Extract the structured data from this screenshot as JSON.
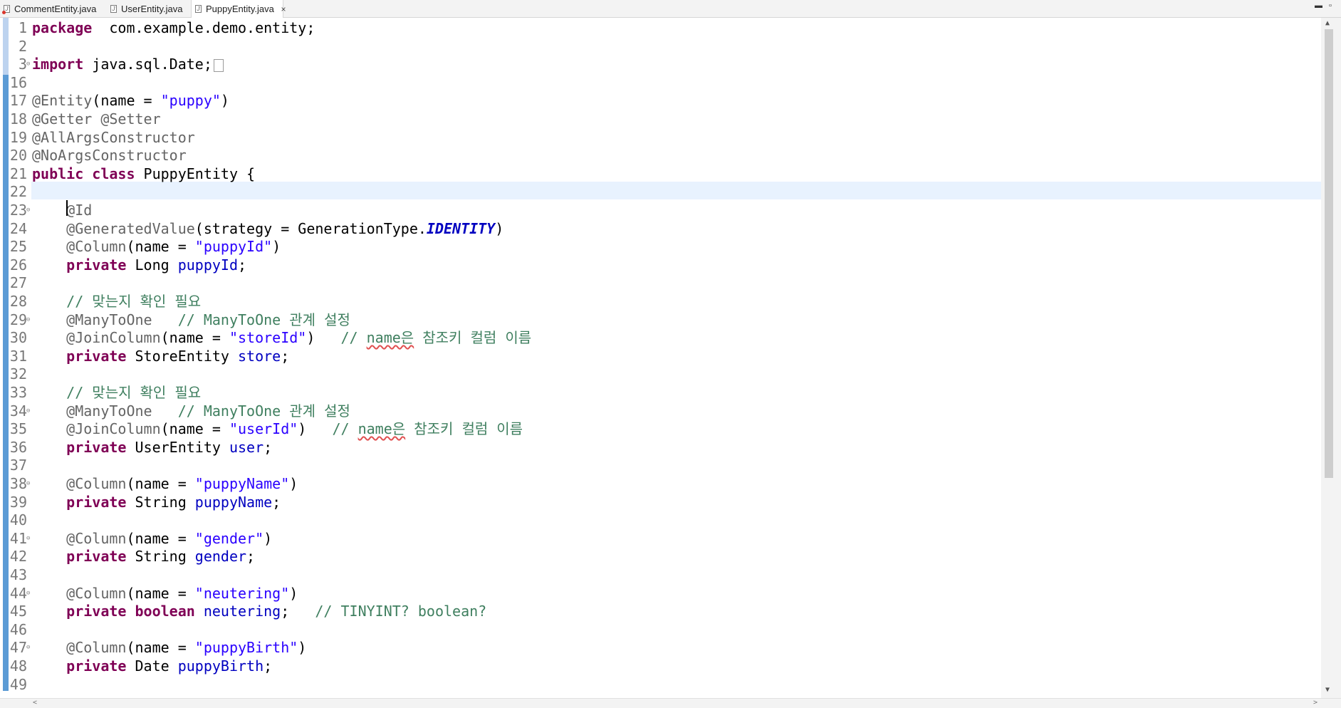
{
  "tabs": [
    {
      "label": "CommentEntity.java",
      "icon": "java-file-error-icon"
    },
    {
      "label": "UserEntity.java",
      "icon": "java-file-icon"
    },
    {
      "label": "PuppyEntity.java",
      "icon": "java-file-icon",
      "active": true
    }
  ],
  "window_controls": {
    "minimize": "▬",
    "restore": "▫"
  },
  "close_glyph": "×",
  "editor": {
    "file": "PuppyEntity.java",
    "cursor_line": 22,
    "lines": [
      {
        "n": "1",
        "segs": [
          [
            "kw",
            "package"
          ],
          [
            "",
            "  com.example.demo.entity;"
          ]
        ]
      },
      {
        "n": "2",
        "segs": []
      },
      {
        "n": "3",
        "fold": true,
        "segs": [
          [
            "kw",
            "import"
          ],
          [
            "",
            " java.sql.Date;"
          ]
        ],
        "collapsed": true
      },
      {
        "n": "16",
        "segs": []
      },
      {
        "n": "17",
        "segs": [
          [
            "an",
            "@Entity"
          ],
          [
            "",
            "(name = "
          ],
          [
            "str",
            "\"puppy\""
          ],
          [
            "",
            ")"
          ]
        ]
      },
      {
        "n": "18",
        "segs": [
          [
            "an",
            "@Getter @Setter"
          ]
        ]
      },
      {
        "n": "19",
        "segs": [
          [
            "an",
            "@AllArgsConstructor"
          ]
        ]
      },
      {
        "n": "20",
        "segs": [
          [
            "an",
            "@NoArgsConstructor"
          ]
        ]
      },
      {
        "n": "21",
        "segs": [
          [
            "kw",
            "public class"
          ],
          [
            "",
            " PuppyEntity {"
          ]
        ]
      },
      {
        "n": "22",
        "segs": [
          [
            "",
            "    "
          ]
        ]
      },
      {
        "n": "23",
        "fold": true,
        "segs": [
          [
            "",
            "    "
          ],
          [
            "an",
            "@Id"
          ]
        ]
      },
      {
        "n": "24",
        "segs": [
          [
            "",
            "    "
          ],
          [
            "an",
            "@GeneratedValue"
          ],
          [
            "",
            "(strategy = GenerationType."
          ],
          [
            "cst",
            "IDENTITY"
          ],
          [
            "",
            ")"
          ]
        ]
      },
      {
        "n": "25",
        "segs": [
          [
            "",
            "    "
          ],
          [
            "an",
            "@Column"
          ],
          [
            "",
            "(name = "
          ],
          [
            "str",
            "\"puppyId\""
          ],
          [
            "",
            ")"
          ]
        ]
      },
      {
        "n": "26",
        "segs": [
          [
            "",
            "    "
          ],
          [
            "kw",
            "private"
          ],
          [
            "",
            " Long "
          ],
          [
            "fld",
            "puppyId"
          ],
          [
            "",
            ";"
          ]
        ]
      },
      {
        "n": "27",
        "segs": []
      },
      {
        "n": "28",
        "segs": [
          [
            "",
            "    "
          ],
          [
            "cm",
            "// 맞는지 확인 필요"
          ]
        ]
      },
      {
        "n": "29",
        "fold": true,
        "segs": [
          [
            "",
            "    "
          ],
          [
            "an",
            "@ManyToOne"
          ],
          [
            "",
            "   "
          ],
          [
            "cm",
            "// ManyToOne 관계 설정"
          ]
        ]
      },
      {
        "n": "30",
        "segs": [
          [
            "",
            "    "
          ],
          [
            "an",
            "@JoinColumn"
          ],
          [
            "",
            "(name = "
          ],
          [
            "str",
            "\"storeId\""
          ],
          [
            "",
            ")   "
          ],
          [
            "cm",
            "// "
          ],
          [
            "cm sq",
            "name은"
          ],
          [
            "cm",
            " 참조키 컬럼 이름"
          ]
        ]
      },
      {
        "n": "31",
        "segs": [
          [
            "",
            "    "
          ],
          [
            "kw",
            "private"
          ],
          [
            "",
            " StoreEntity "
          ],
          [
            "fld",
            "store"
          ],
          [
            "",
            ";"
          ]
        ]
      },
      {
        "n": "32",
        "segs": []
      },
      {
        "n": "33",
        "segs": [
          [
            "",
            "    "
          ],
          [
            "cm",
            "// 맞는지 확인 필요"
          ]
        ]
      },
      {
        "n": "34",
        "fold": true,
        "segs": [
          [
            "",
            "    "
          ],
          [
            "an",
            "@ManyToOne"
          ],
          [
            "",
            "   "
          ],
          [
            "cm",
            "// ManyToOne 관계 설정"
          ]
        ]
      },
      {
        "n": "35",
        "segs": [
          [
            "",
            "    "
          ],
          [
            "an",
            "@JoinColumn"
          ],
          [
            "",
            "(name = "
          ],
          [
            "str",
            "\"userId\""
          ],
          [
            "",
            ")   "
          ],
          [
            "cm",
            "// "
          ],
          [
            "cm sq",
            "name은"
          ],
          [
            "cm",
            " 참조키 컬럼 이름"
          ]
        ]
      },
      {
        "n": "36",
        "segs": [
          [
            "",
            "    "
          ],
          [
            "kw",
            "private"
          ],
          [
            "",
            " UserEntity "
          ],
          [
            "fld",
            "user"
          ],
          [
            "",
            ";"
          ]
        ]
      },
      {
        "n": "37",
        "segs": []
      },
      {
        "n": "38",
        "fold": true,
        "segs": [
          [
            "",
            "    "
          ],
          [
            "an",
            "@Column"
          ],
          [
            "",
            "(name = "
          ],
          [
            "str",
            "\"puppyName\""
          ],
          [
            "",
            ")"
          ]
        ]
      },
      {
        "n": "39",
        "segs": [
          [
            "",
            "    "
          ],
          [
            "kw",
            "private"
          ],
          [
            "",
            " String "
          ],
          [
            "fld",
            "puppyName"
          ],
          [
            "",
            ";"
          ]
        ]
      },
      {
        "n": "40",
        "segs": []
      },
      {
        "n": "41",
        "fold": true,
        "segs": [
          [
            "",
            "    "
          ],
          [
            "an",
            "@Column"
          ],
          [
            "",
            "(name = "
          ],
          [
            "str",
            "\"gender\""
          ],
          [
            "",
            ")"
          ]
        ]
      },
      {
        "n": "42",
        "segs": [
          [
            "",
            "    "
          ],
          [
            "kw",
            "private"
          ],
          [
            "",
            " String "
          ],
          [
            "fld",
            "gender"
          ],
          [
            "",
            ";"
          ]
        ]
      },
      {
        "n": "43",
        "segs": []
      },
      {
        "n": "44",
        "fold": true,
        "segs": [
          [
            "",
            "    "
          ],
          [
            "an",
            "@Column"
          ],
          [
            "",
            "(name = "
          ],
          [
            "str",
            "\"neutering\""
          ],
          [
            "",
            ")"
          ]
        ]
      },
      {
        "n": "45",
        "segs": [
          [
            "",
            "    "
          ],
          [
            "kw",
            "private boolean"
          ],
          [
            "",
            " "
          ],
          [
            "fld",
            "neutering"
          ],
          [
            "",
            ";   "
          ],
          [
            "cm",
            "// TINYINT? boolean?"
          ]
        ]
      },
      {
        "n": "46",
        "segs": []
      },
      {
        "n": "47",
        "fold": true,
        "segs": [
          [
            "",
            "    "
          ],
          [
            "an",
            "@Column"
          ],
          [
            "",
            "(name = "
          ],
          [
            "str",
            "\"puppyBirth\""
          ],
          [
            "",
            ")"
          ]
        ]
      },
      {
        "n": "48",
        "segs": [
          [
            "",
            "    "
          ],
          [
            "kw",
            "private"
          ],
          [
            "",
            " Date "
          ],
          [
            "fld",
            "puppyBirth"
          ],
          [
            "",
            ";"
          ]
        ]
      },
      {
        "n": "49",
        "segs": []
      }
    ]
  },
  "scrollbar": {
    "up_arrow": "▲",
    "down_arrow": "▼",
    "left_arrow": "<",
    "right_arrow": ">"
  }
}
